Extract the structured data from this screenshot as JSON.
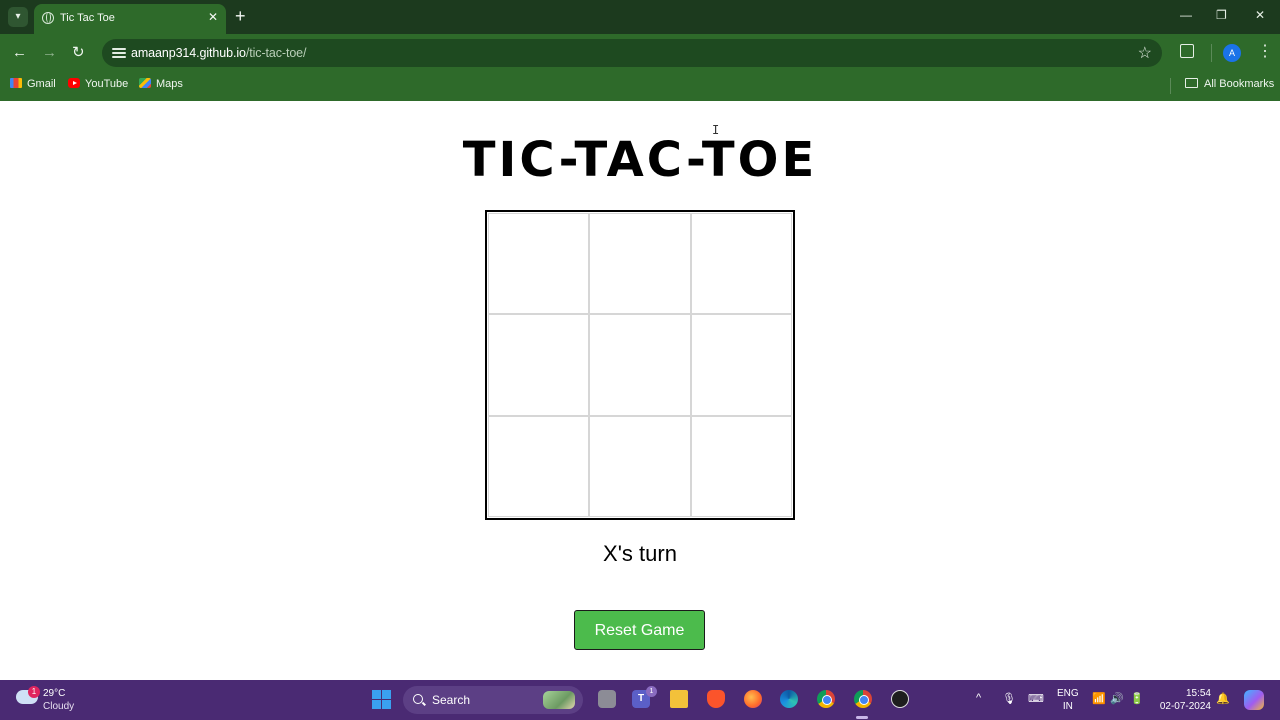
{
  "browser": {
    "tab": {
      "title": "Tic Tac Toe",
      "close": "✕"
    },
    "new_tab": "+",
    "window_controls": {
      "minimize": "—",
      "restore": "❐",
      "close": "✕"
    },
    "nav": {
      "back": "←",
      "forward": "→",
      "reload": "↻"
    },
    "url": {
      "host": "amaanp314.github.io",
      "path": "/tic-tac-toe/"
    },
    "bookmark_star": "☆",
    "profile_initial": "A",
    "menu": "⋮",
    "bookmarks": [
      {
        "label": "Gmail"
      },
      {
        "label": "YouTube"
      },
      {
        "label": "Maps"
      }
    ],
    "all_bookmarks": "All Bookmarks"
  },
  "game": {
    "title": "TIC-TAC-TOE",
    "board": [
      "",
      "",
      "",
      "",
      "",
      "",
      "",
      "",
      ""
    ],
    "status": "X's turn",
    "reset_label": "Reset Game"
  },
  "taskbar": {
    "weather": {
      "badge": "1",
      "temp": "29°C",
      "desc": "Cloudy"
    },
    "search_label": "Search",
    "teams_badge": "1",
    "teams_letter": "T",
    "language": {
      "line1": "ENG",
      "line2": "IN"
    },
    "clock": {
      "time": "15:54",
      "date": "02-07-2024"
    },
    "tray": {
      "chevron": "^",
      "mic": "🎙",
      "keyboard": "⌨",
      "wifi": "📶",
      "volume": "🔊",
      "battery": "🔋",
      "bell": "🔔"
    }
  }
}
